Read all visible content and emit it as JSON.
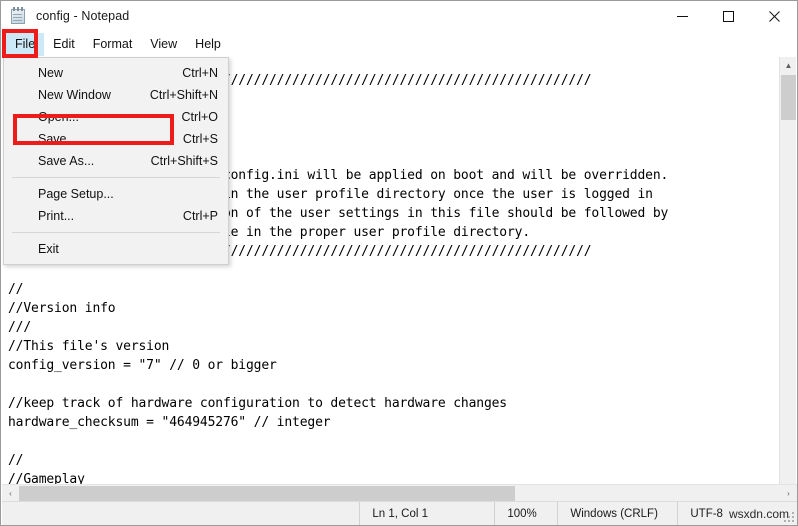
{
  "window": {
    "title": "config - Notepad",
    "icon": "notepad-icon",
    "minimize_label": "Minimize",
    "maximize_label": "Maximize",
    "close_label": "Close"
  },
  "menubar": {
    "items": [
      {
        "label": "File",
        "active": true
      },
      {
        "label": "Edit",
        "active": false
      },
      {
        "label": "Format",
        "active": false
      },
      {
        "label": "View",
        "active": false
      },
      {
        "label": "Help",
        "active": false
      }
    ]
  },
  "file_menu": {
    "open": true,
    "items": [
      {
        "label": "New",
        "accel": "Ctrl+N",
        "type": "item"
      },
      {
        "label": "New Window",
        "accel": "Ctrl+Shift+N",
        "type": "item"
      },
      {
        "label": "Open...",
        "accel": "Ctrl+O",
        "type": "item"
      },
      {
        "label": "Save",
        "accel": "Ctrl+S",
        "type": "item",
        "highlighted": true
      },
      {
        "label": "Save As...",
        "accel": "Ctrl+Shift+S",
        "type": "item"
      },
      {
        "label": "",
        "accel": "",
        "type": "separator"
      },
      {
        "label": "Page Setup...",
        "accel": "",
        "type": "item"
      },
      {
        "label": "Print...",
        "accel": "Ctrl+P",
        "type": "item"
      },
      {
        "label": "",
        "accel": "",
        "type": "separator"
      },
      {
        "label": "Exit",
        "accel": "",
        "type": "item"
      }
    ]
  },
  "annotations": {
    "color": "#ee1b1b",
    "boxes": [
      {
        "target": "file-menu-button"
      },
      {
        "target": "file-menu-item-save"
      }
    ]
  },
  "editor": {
    "text": "////////////////////////////////////////////////////////////////////////////\n//\n//config.ini\n//\n//\n//Values written in players/config.ini will be applied on boot and will be overridden.\n//by any config.ini's found in the user profile directory once the user is logged in\n//Because of this, any edition of the user settings in this file should be followed by\n//the edition of the same file in the proper user profile directory.\n////////////////////////////////////////////////////////////////////////////\n\n//\n//Version info\n///\n//This file's version\nconfig_version = \"7\" // 0 or bigger\n\n//keep track of hardware configuration to detect hardware changes\nhardware_checksum = \"464945276\" // integer\n\n//\n//Gameplay"
  },
  "scrollbars": {
    "vertical_up_arrow": "▲",
    "vertical_down_arrow": "▼",
    "horizontal_left_arrow": "‹",
    "horizontal_right_arrow": "›"
  },
  "statusbar": {
    "cursor_position": "Ln 1, Col 1",
    "zoom": "100%",
    "line_ending": "Windows (CRLF)",
    "encoding": "UTF-8",
    "watermark": "wsxdn.com"
  }
}
